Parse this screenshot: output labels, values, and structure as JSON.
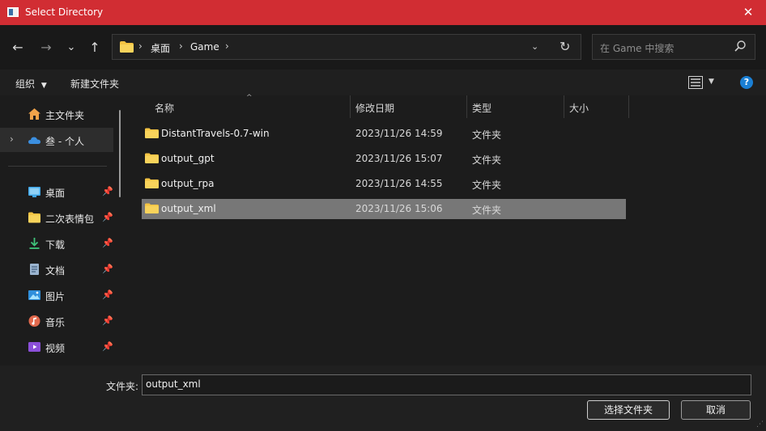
{
  "window": {
    "title": "Select Directory"
  },
  "nav": {
    "back": "←",
    "forward": "→",
    "recent": "⌄",
    "up": "↑"
  },
  "breadcrumb": {
    "items": [
      "桌面",
      "Game"
    ]
  },
  "search": {
    "placeholder": "在 Game 中搜索"
  },
  "toolbar": {
    "organize": "组织",
    "new_folder": "新建文件夹"
  },
  "sidebar": {
    "items": [
      {
        "label": "主文件夹",
        "icon": "home-icon",
        "pinned": false
      },
      {
        "label": "叁 - 个人",
        "icon": "onedrive-cloud-icon",
        "pinned": false
      },
      {
        "label": "桌面",
        "icon": "desktop-icon",
        "pinned": true
      },
      {
        "label": "二次表情包",
        "icon": "folder-icon",
        "pinned": true
      },
      {
        "label": "下载",
        "icon": "download-icon",
        "pinned": true
      },
      {
        "label": "文档",
        "icon": "document-icon",
        "pinned": true
      },
      {
        "label": "图片",
        "icon": "pictures-icon",
        "pinned": true
      },
      {
        "label": "音乐",
        "icon": "music-icon",
        "pinned": true
      },
      {
        "label": "视频",
        "icon": "video-icon",
        "pinned": true
      }
    ]
  },
  "columns": {
    "name": "名称",
    "date": "修改日期",
    "type": "类型",
    "size": "大小"
  },
  "files": [
    {
      "name": "DistantTravels-0.7-win",
      "date": "2023/11/26 14:59",
      "type": "文件夹",
      "selected": false
    },
    {
      "name": "output_gpt",
      "date": "2023/11/26 15:07",
      "type": "文件夹",
      "selected": false
    },
    {
      "name": "output_rpa",
      "date": "2023/11/26 14:55",
      "type": "文件夹",
      "selected": false
    },
    {
      "name": "output_xml",
      "date": "2023/11/26 15:06",
      "type": "文件夹",
      "selected": true
    }
  ],
  "footer": {
    "folder_label": "文件夹:",
    "folder_value": "output_xml",
    "select_button": "选择文件夹",
    "cancel_button": "取消"
  },
  "colors": {
    "titlebar": "#d12d33",
    "selection": "#777777",
    "folder": "#f3c343",
    "help": "#1a7fd4"
  }
}
